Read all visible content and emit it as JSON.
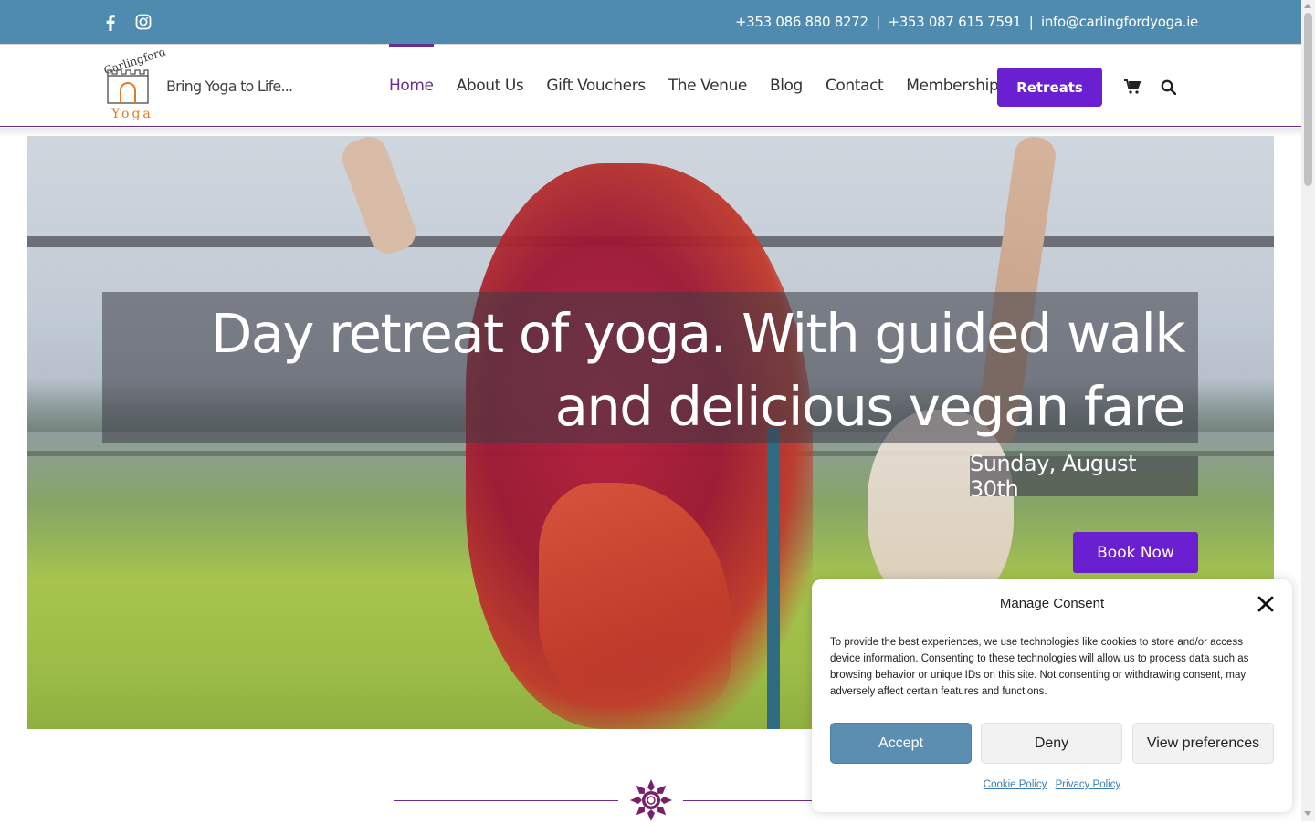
{
  "topbar": {
    "social_icons": [
      "facebook-icon",
      "instagram-icon"
    ],
    "phone1": "+353 086 880 8272",
    "phone_sep": "|",
    "phone2": "+353 087 615 7591",
    "email_sep": "|",
    "email": "info@carlingfordyoga.ie",
    "bg_color": "#4f8aaf"
  },
  "header": {
    "logo": {
      "brand_top": "Carlingford",
      "brand_bottom": "Yoga",
      "tagline": "Bring Yoga to Life..."
    },
    "nav": [
      {
        "label": "Home",
        "active": true
      },
      {
        "label": "About Us"
      },
      {
        "label": "Gift Vouchers"
      },
      {
        "label": "The Venue"
      },
      {
        "label": "Blog"
      },
      {
        "label": "Contact"
      },
      {
        "label": "Membership"
      }
    ],
    "cta_label": "Retreats",
    "icons": [
      "cart-icon",
      "search-icon"
    ],
    "accent_color": "#6b2c91",
    "button_color": "#6a1fd0"
  },
  "hero": {
    "headline": "Day retreat of yoga. With guided walk and delicious vegan fare",
    "date": "Sunday, August 30th",
    "button_label": "Book Now"
  },
  "consent": {
    "title": "Manage Consent",
    "text": "To provide the best experiences, we use technologies like cookies to store and/or access device information. Consenting to these technologies will allow us to process data such as browsing behavior or unique IDs on this site. Not consenting or withdrawing consent, may adversely affect certain features and functions.",
    "accept_label": "Accept",
    "deny_label": "Deny",
    "prefs_label": "View preferences",
    "cookie_policy": "Cookie Policy",
    "privacy_policy": "Privacy Policy",
    "accept_color": "#5c8eb2"
  }
}
